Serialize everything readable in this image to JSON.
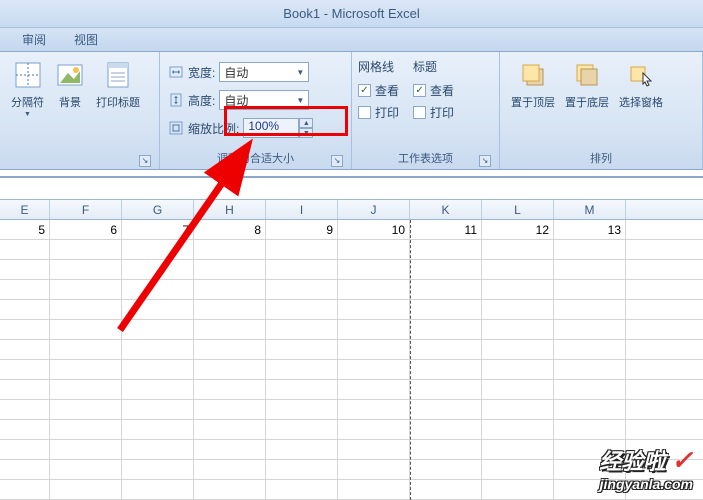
{
  "title": "Book1 - Microsoft Excel",
  "tabs": {
    "review": "审阅",
    "view": "视图"
  },
  "ribbon": {
    "group1": {
      "breaks": "分隔符",
      "background": "背景",
      "print_titles": "打印标题"
    },
    "group2": {
      "label": "调整为合适大小",
      "width_label": "宽度:",
      "height_label": "高度:",
      "scale_label": "缩放比例:",
      "auto": "自动",
      "scale_value": "100%"
    },
    "group3": {
      "label": "工作表选项",
      "gridlines": "网格线",
      "headings": "标题",
      "view_chk": "查看",
      "print_chk": "打印"
    },
    "group4": {
      "label": "排列",
      "bring_front": "置于顶层",
      "send_back": "置于底层",
      "selection_pane": "选择窗格"
    }
  },
  "columns": [
    "E",
    "F",
    "G",
    "H",
    "I",
    "J",
    "K",
    "L",
    "M"
  ],
  "row1": [
    "5",
    "6",
    "7",
    "8",
    "9",
    "10",
    "11",
    "12",
    "13"
  ],
  "watermark": {
    "name": "经验啦",
    "url": "jingyanla.com"
  }
}
